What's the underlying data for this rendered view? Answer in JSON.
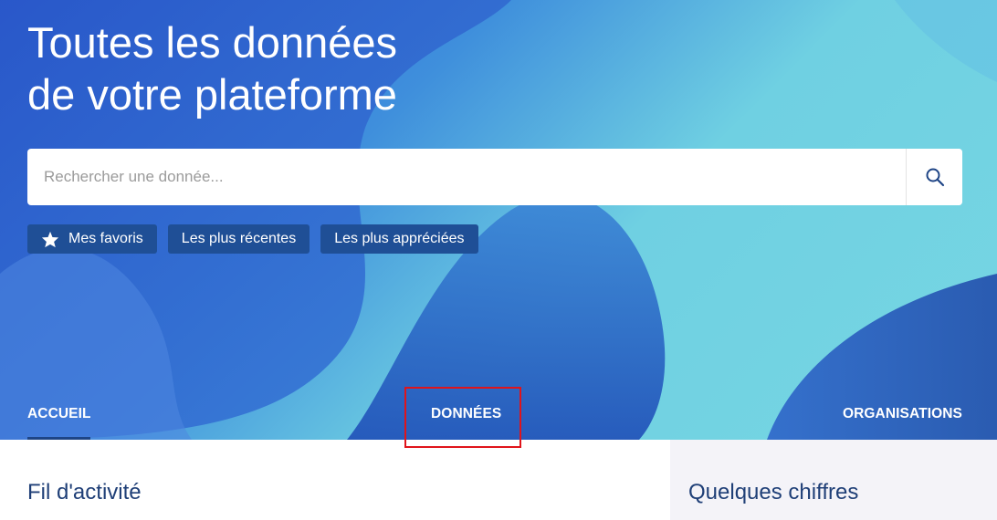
{
  "hero": {
    "title_line1": "Toutes les données",
    "title_line2": "de votre plateforme"
  },
  "search": {
    "placeholder": "Rechercher une donnée...",
    "value": "",
    "button_icon": "search-icon"
  },
  "chips": [
    {
      "label": "Mes favoris",
      "icon": "star-icon"
    },
    {
      "label": "Les plus récentes"
    },
    {
      "label": "Les plus appréciées"
    }
  ],
  "tabs": [
    {
      "label": "ACCUEIL",
      "active": true
    },
    {
      "label": "DONNÉES",
      "active": false
    },
    {
      "label": "ORGANISATIONS",
      "active": false
    }
  ],
  "sections": {
    "activity_title": "Fil d'activité",
    "figures_title": "Quelques chiffres"
  },
  "colors": {
    "chip_bg": "#1f4f96",
    "section_title": "#1f3f77",
    "highlight": "#e0141b",
    "right_panel_bg": "#f4f3f8"
  }
}
